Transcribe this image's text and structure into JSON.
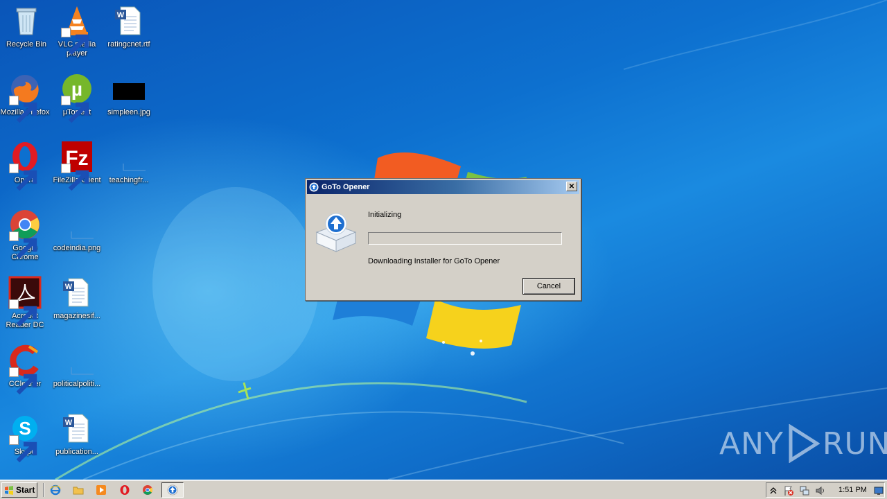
{
  "desktop": {
    "icons": [
      {
        "label": "Recycle Bin"
      },
      {
        "label": "VLC media player"
      },
      {
        "label": "ratingcnet.rtf"
      },
      {
        "label": "Mozilla Firefox"
      },
      {
        "label": "µTorrent"
      },
      {
        "label": "simpleen.jpg"
      },
      {
        "label": "Opera"
      },
      {
        "label": "FileZilla Client"
      },
      {
        "label": "teachingfr..."
      },
      {
        "label": "Google Chrome"
      },
      {
        "label": "codeindia.png"
      },
      {
        "label": "Acrobat Reader DC"
      },
      {
        "label": "magazinesif..."
      },
      {
        "label": "CCleaner"
      },
      {
        "label": "politicalpoliti..."
      },
      {
        "label": "Skype"
      },
      {
        "label": "publication..."
      }
    ],
    "watermark": {
      "left": "ANY",
      "right": "RUN"
    }
  },
  "dialog": {
    "title": "GoTo Opener",
    "close_label": "✕",
    "status": "Initializing",
    "progress_percent": 0,
    "detail": "Downloading Installer for GoTo Opener",
    "cancel_label": "Cancel"
  },
  "taskbar": {
    "start_label": "Start",
    "quick_launch": [
      "ie-icon",
      "explorer-icon",
      "media-player-icon",
      "opera-icon",
      "chrome-icon"
    ],
    "active_task": "goto-opener-icon",
    "clock": "1:51 PM"
  },
  "colors": {
    "title_gradient_start": "#0a246a",
    "title_gradient_end": "#a6caf0",
    "dialog_bg": "#d4d0c8",
    "desktop_blue": "#0d70cf"
  }
}
